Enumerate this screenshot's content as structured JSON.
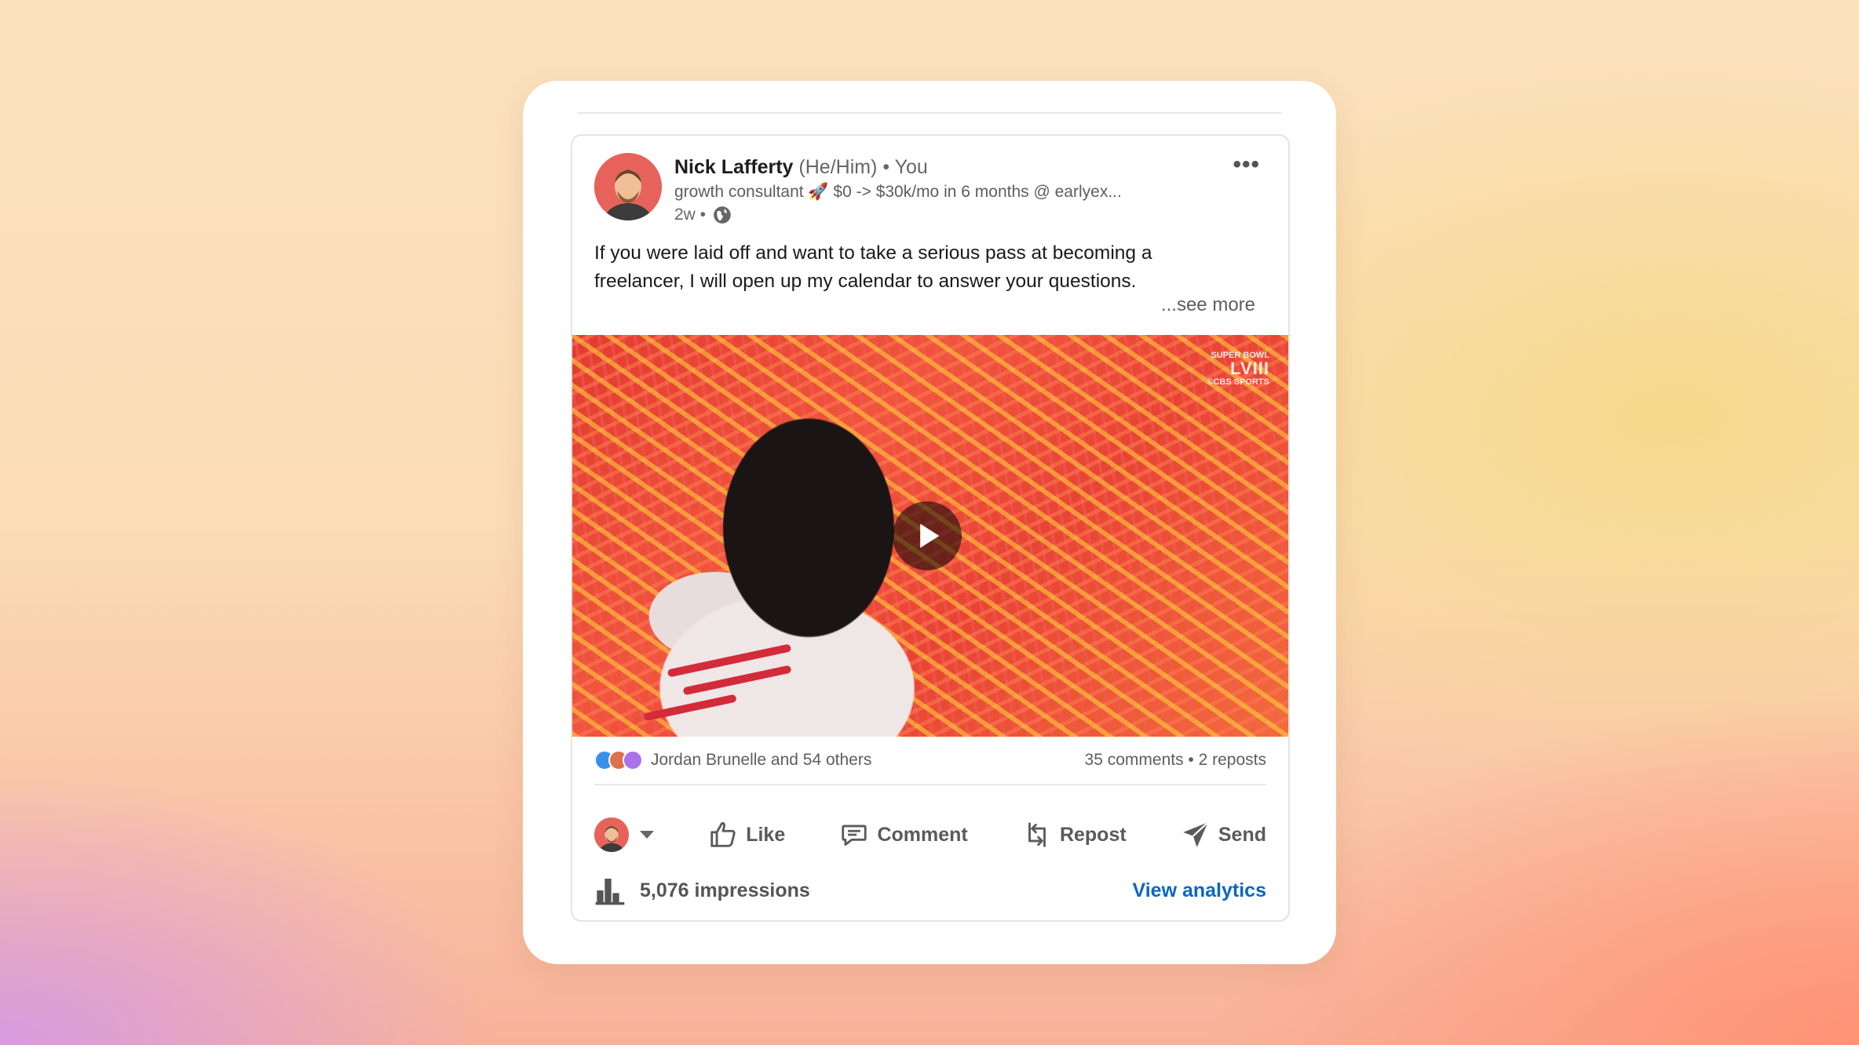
{
  "post": {
    "author_name": "Nick Lafferty",
    "pronouns": "(He/Him)",
    "relation": "• You",
    "headline": "growth consultant 🚀 $0 -> $30k/mo in 6 months @ earlyex...",
    "time": "2w •",
    "text": "If you were laid off and want to take a serious pass at becoming a freelancer, I will open up my calendar to answer your questions.",
    "see_more": "...see more",
    "menu": "•••"
  },
  "media": {
    "watermark_top": "SUPER BOWL",
    "watermark_big": "LVIII",
    "watermark_bottom": "©CBS SPORTS"
  },
  "social": {
    "reactions_text": "Jordan Brunelle and 54 others",
    "counts_text": "35 comments • 2 reposts"
  },
  "actions": {
    "like": "Like",
    "comment": "Comment",
    "repost": "Repost",
    "send": "Send"
  },
  "stats": {
    "impressions": "5,076 impressions",
    "analytics_link": "View analytics"
  },
  "colors": {
    "link_blue": "#0a66c2",
    "avatar_bg": "#e7625a"
  }
}
